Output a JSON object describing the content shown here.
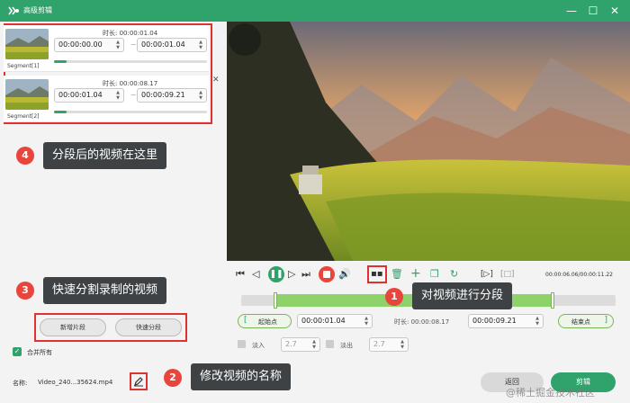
{
  "window": {
    "title": "高级剪辑",
    "minimize": "—",
    "maximize": "☐",
    "close": "✕"
  },
  "segments": [
    {
      "label": "Segment[1]",
      "duration_label": "时长: 00:00:01.04",
      "start": "00:00:00.00",
      "end": "00:00:01.04",
      "progress": 0.08
    },
    {
      "label": "Segment[2]",
      "duration_label": "时长: 00:00:08.17",
      "start": "00:00:01.04",
      "end": "00:00:09.21",
      "progress": 0.08
    }
  ],
  "tilde": "~",
  "annotations": {
    "a1": {
      "num": "1",
      "text": "对视频进行分段"
    },
    "a2": {
      "num": "2",
      "text": "修改视频的名称"
    },
    "a3": {
      "num": "3",
      "text": "快速分割录制的视频"
    },
    "a4": {
      "num": "4",
      "text": "分段后的视频在这里"
    }
  },
  "buttons": {
    "new_segment": "新增片段",
    "quick_split": "快速分段",
    "merge_all": "合并所有",
    "back": "返回",
    "export": "剪辑"
  },
  "name": {
    "label": "名称:",
    "value": "Video_240...35624.mp4"
  },
  "playback": {
    "time": "00:00:06.06/00:00:11.22"
  },
  "range": {
    "start_label": "起始点",
    "start_value": "00:00:01.04",
    "duration_label": "时长: 00:00:08.17",
    "end_value": "00:00:09.21",
    "end_label": "结束点"
  },
  "fade": {
    "in_label": "淡入",
    "in_value": "2.7",
    "out_label": "淡出",
    "out_value": "2.7"
  },
  "watermark": "@稀土掘金技术社区",
  "colors": {
    "accent": "#2fa36b",
    "stop": "#e8453c",
    "highlight": "#e03131"
  }
}
